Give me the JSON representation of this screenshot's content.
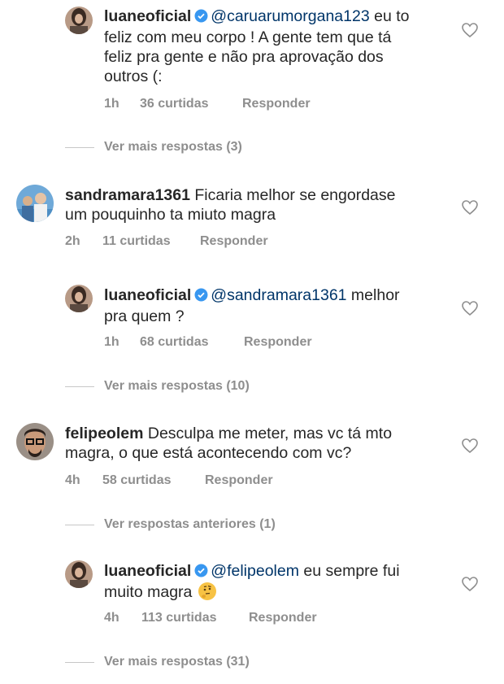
{
  "colors": {
    "accent_mention": "#003569",
    "meta_grey": "#8e8e8e",
    "verified_blue": "#3897f0"
  },
  "threads": [
    {
      "user": "luaneoficial",
      "verified": true,
      "mention": "@caruarumorgana123",
      "text_line1": " eu to",
      "text_line2": "feliz com meu corpo ! A gente tem que tá",
      "text_line3": "feliz pra gente e não pra aprovação dos",
      "text_line4": "outros (:",
      "time": "1h",
      "likes": "36 curtidas",
      "reply": "Responder"
    },
    {
      "more": "Ver mais respostas (3)"
    },
    {
      "user": "sandramara1361",
      "verified": false,
      "text_line1": "Ficaria melhor se engordase",
      "text_line2": "um pouquinho ta miuto magra",
      "time": "2h",
      "likes": "11 curtidas",
      "reply": "Responder"
    },
    {
      "user": "luaneoficial",
      "verified": true,
      "mention": "@sandramara1361",
      "text_line1": " melhor",
      "text_line2": "pra quem ?",
      "time": "1h",
      "likes": "68 curtidas",
      "reply": "Responder"
    },
    {
      "more": "Ver mais respostas (10)"
    },
    {
      "user": "felipeolem",
      "verified": false,
      "text_line1": "Desculpa me meter, mas vc tá mto",
      "text_line2": "magra, o que está acontecendo com vc?",
      "time": "4h",
      "likes": "58 curtidas",
      "reply": "Responder"
    },
    {
      "more": "Ver respostas anteriores (1)"
    },
    {
      "user": "luaneoficial",
      "verified": true,
      "mention": "@felipeolem",
      "text_line1": " eu sempre fui",
      "text_line2": "muito magra",
      "emoji": "thinking-face",
      "time": "4h",
      "likes": "113 curtidas",
      "reply": "Responder"
    },
    {
      "more": "Ver mais respostas (31)"
    }
  ]
}
